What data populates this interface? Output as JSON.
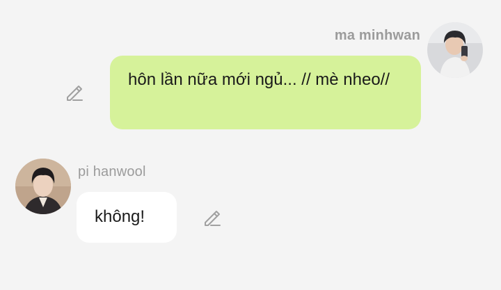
{
  "messages": [
    {
      "sender": "ma minhwan",
      "text": "hôn lần nữa mới ngủ... // mè nheo//",
      "direction": "outgoing",
      "bubble_color": "#d6f29a"
    },
    {
      "sender": "pi hanwool",
      "text": "không!",
      "direction": "incoming",
      "bubble_color": "#ffffff"
    }
  ],
  "icons": {
    "edit": "pencil-icon"
  },
  "colors": {
    "background": "#f4f4f4",
    "sender_name": "#9b9b9b",
    "icon": "#a0a0a0"
  }
}
